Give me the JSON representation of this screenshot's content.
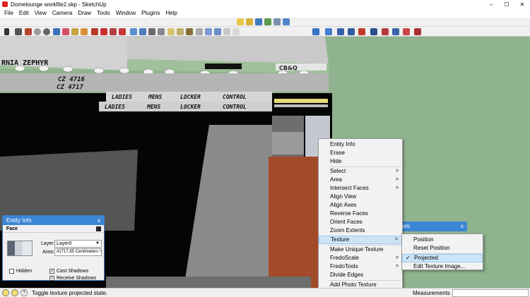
{
  "window": {
    "title": "Domelounge workfile2.skp - SketchUp",
    "controls": [
      "–",
      "☐",
      "✕"
    ]
  },
  "menubar": [
    "File",
    "Edit",
    "View",
    "Camera",
    "Draw",
    "Tools",
    "Window",
    "Plugins",
    "Help"
  ],
  "scene": {
    "signs": {
      "marquee": "RNIA ZEPHYR",
      "car_top": "CZ 4716",
      "car_bottom": "CZ 4717",
      "door_code": "CB&Q",
      "locker_row1": [
        "LADIES",
        "MENS",
        "LOCKER",
        "CONTROL"
      ],
      "locker_row2": [
        "LADIES",
        "MENS",
        "LOCKER",
        "CONTROL"
      ]
    }
  },
  "entity_info": {
    "title": "Entity Info",
    "close": "x",
    "type": "Face",
    "layer_label": "Layer:",
    "layer_value": "Layer0",
    "area_label": "Area:",
    "area_value": "41717,85 Centimeters ²",
    "hidden_label": "Hidden",
    "hidden_checked": false,
    "cast_shadows_label": "Cast Shadows",
    "cast_shadows_checked": true,
    "receive_shadows_label": "Receive Shadows",
    "receive_shadows_checked": true
  },
  "background_panel": {
    "title": "ges",
    "close": "x"
  },
  "context_menu": {
    "items": [
      {
        "label": "Entity Info",
        "submenu": false
      },
      {
        "label": "Erase",
        "submenu": false
      },
      {
        "label": "Hide",
        "submenu": false
      },
      {
        "label": "Select",
        "submenu": true
      },
      {
        "label": "Area",
        "submenu": true
      },
      {
        "label": "Intersect Faces",
        "submenu": true
      },
      {
        "label": "Align View",
        "submenu": false
      },
      {
        "label": "Align Axes",
        "submenu": false
      },
      {
        "label": "Reverse Faces",
        "submenu": false
      },
      {
        "label": "Orient Faces",
        "submenu": false
      },
      {
        "label": "Zoom Extents",
        "submenu": false
      },
      {
        "label": "Texture",
        "submenu": true,
        "highlighted": true
      },
      {
        "label": "Make Unique Texture",
        "submenu": false
      },
      {
        "label": "FredoScale",
        "submenu": true
      },
      {
        "label": "FredoTools",
        "submenu": true
      },
      {
        "label": "Divide Edges",
        "submenu": false
      },
      {
        "label": "Add Photo Texture",
        "submenu": false
      }
    ]
  },
  "texture_submenu": {
    "items": [
      {
        "label": "Position",
        "checked": false
      },
      {
        "label": "Reset Position",
        "checked": false
      },
      {
        "label": "Projected",
        "checked": true,
        "highlighted": true
      },
      {
        "label": "Edit Texture Image...",
        "checked": false
      }
    ]
  },
  "statusbar": {
    "message": "Toggle texture projected state.",
    "measurements_label": "Measurements",
    "measurements_value": ""
  }
}
